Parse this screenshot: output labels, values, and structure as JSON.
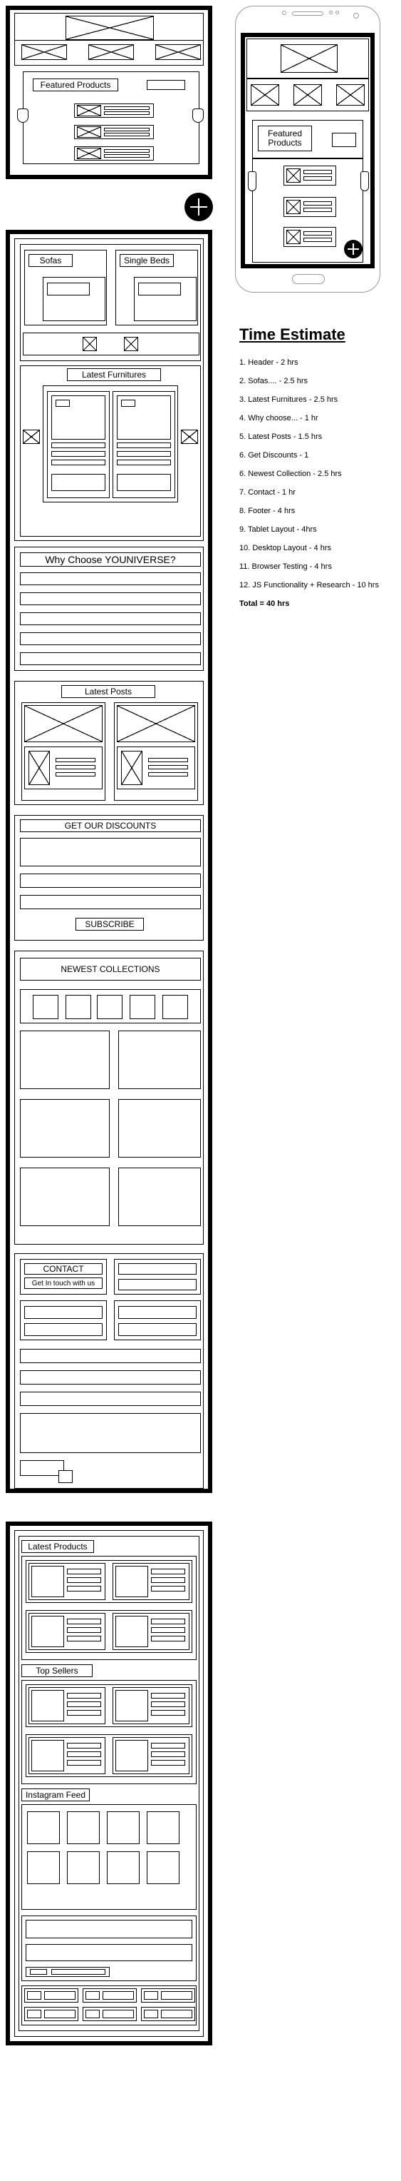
{
  "labels": {
    "featured_products": "Featured Products",
    "featured_line1": "Featured",
    "featured_line2": "Products",
    "sofas": "Sofas",
    "single_beds": "Single Beds",
    "latest_furnitures": "Latest Furnitures",
    "why_choose": "Why Choose YOUNIVERSE?",
    "latest_posts": "Latest Posts",
    "get_discounts": "GET OUR DISCOUNTS",
    "subscribe": "SUBSCRIBE",
    "newest_collections": "NEWEST COLLECTIONS",
    "contact": "CONTACT",
    "get_in_touch": "Get In touch with us",
    "latest_products": "Latest Products",
    "top_sellers": "Top Sellers",
    "instagram_feed": "Instagram Feed"
  },
  "estimate": {
    "title": "Time Estimate",
    "items": [
      "1. Header - 2 hrs",
      "2. Sofas.... - 2.5 hrs",
      "3. Latest Furnitures - 2.5 hrs",
      "4. Why choose... - 1 hr",
      "5. Latest Posts - 1.5 hrs",
      "6. Get Discounts - 1",
      "6. Newest Collection - 2.5 hrs",
      "7. Contact - 1 hr",
      "8. Footer - 4 hrs",
      "9. Tablet Layout - 4hrs",
      "10. Desktop Layout - 4 hrs",
      "11. Browser Testing - 4 hrs",
      "12. JS Functionality + Research - 10 hrs"
    ],
    "total": "Total = 40 hrs"
  }
}
